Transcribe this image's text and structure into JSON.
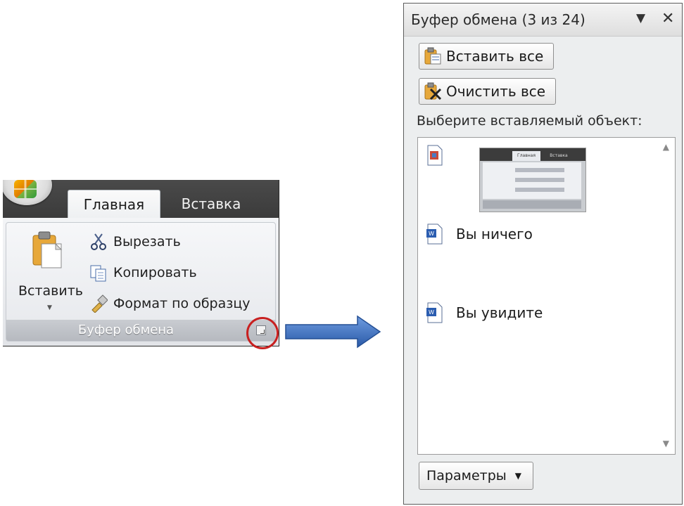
{
  "ribbon": {
    "tabs": [
      {
        "label": "Главная",
        "active": true
      },
      {
        "label": "Вставка",
        "active": false
      }
    ],
    "paste_label": "Вставить",
    "commands": [
      {
        "label": "Вырезать",
        "icon": "scissors-icon"
      },
      {
        "label": "Копировать",
        "icon": "copy-icon"
      },
      {
        "label": "Формат по образцу",
        "icon": "format-painter-icon"
      }
    ],
    "group_title": "Буфер обмена"
  },
  "pane": {
    "title": "Буфер обмена (3 из 24)",
    "paste_all_label": "Вставить все",
    "clear_all_label": "Очистить все",
    "choose_label": "Выберите вставляемый объект:",
    "items": [
      {
        "type": "image",
        "icon": "image-doc-icon"
      },
      {
        "type": "text",
        "text": "Вы ничего",
        "icon": "word-doc-icon"
      },
      {
        "type": "text",
        "text": "Вы увидите",
        "icon": "word-doc-icon"
      }
    ],
    "thumbnail": {
      "tab1": "Главная",
      "tab2": "Вставка"
    },
    "options_label": "Параметры"
  },
  "colors": {
    "ribbon_dark": "#3b3b3b",
    "highlight_circle": "#c82020",
    "arrow_blue": "#3b6fbf"
  }
}
